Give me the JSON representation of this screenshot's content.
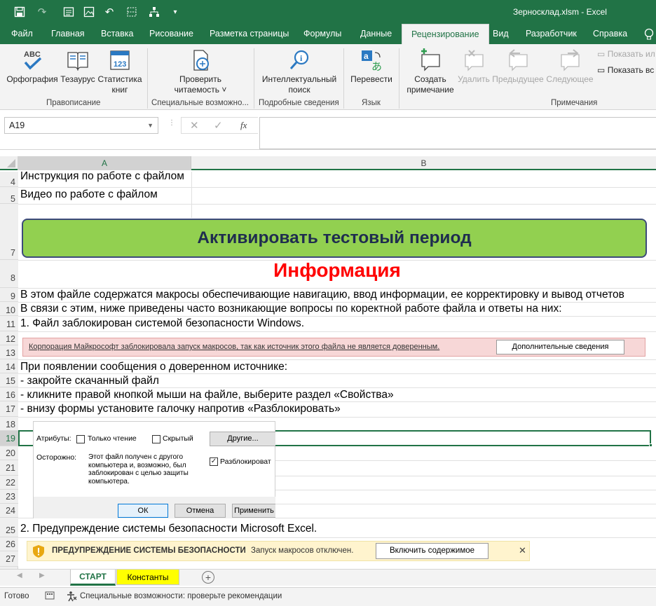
{
  "window": {
    "title": "Зерносклад.xlsm  -  Excel"
  },
  "ribbon_tabs": [
    "Файл",
    "Главная",
    "Вставка",
    "Рисование",
    "Разметка страницы",
    "Формулы",
    "Данные",
    "Рецензирование",
    "Вид",
    "Разработчик",
    "Справка"
  ],
  "ribbon": {
    "spelling": "Орфография",
    "thesaurus": "Тезаурус",
    "stats_line1": "Статистика",
    "stats_line2": "книг",
    "check_line1": "Проверить",
    "check_line2": "читаемость ˅",
    "smart_line1": "Интеллектуальный",
    "smart_line2": "поиск",
    "translate": "Перевести",
    "new_comment_line1": "Создать",
    "new_comment_line2": "примечание",
    "delete": "Удалить",
    "previous": "Предыдущее",
    "next": "Следующее",
    "show_note": "Показать ил",
    "show_all": "Показать вс",
    "groups": {
      "proofing": "Правописание",
      "accessibility": "Специальные возможно...",
      "insights": "Подробные сведения",
      "language": "Язык",
      "comments": "Примечания"
    },
    "icons": [
      "spellcheck-icon",
      "thesaurus-icon",
      "workbook-stats-icon",
      "accessibility-check-icon",
      "smart-lookup-icon",
      "translate-icon",
      "new-comment-icon",
      "delete-comment-icon",
      "previous-comment-icon",
      "next-comment-icon"
    ]
  },
  "formula_bar": {
    "name_box": "A19",
    "cancel": "✕",
    "enter": "✓",
    "fx": "fx"
  },
  "columns": {
    "a": "A",
    "b": "B"
  },
  "rows": {
    "r4": "Инструкция по работе с файлом",
    "r5": "Видео по работе с файлом",
    "r7_button": "Активировать тестовый период",
    "r8_title": "Информация",
    "r9": "В этом файле содержатся макросы обеспечивающие навигацию, ввод информации, ее корректировку и вывод отчетов",
    "r10": "В связи с этим, ниже приведены часто возникающие  вопросы по коректной работе файла и ответы на них:",
    "r11": "1. Файл заблокирован системой безопасности Windows.",
    "r14": "При появлении сообщения о доверенном источнике:",
    "r15": "- закройте скачанный файл",
    "r16": "- кликните правой кнопкой мыши на файле, выберите раздел «Свойства»",
    "r17": "- внизу формы установите галочку напротив «Разблокировать»",
    "r25": "2. Предупреждение системы безопасности Microsoft Excel."
  },
  "row_numbers": [
    "4",
    "5",
    "7",
    "8",
    "9",
    "10",
    "11",
    "12",
    "13",
    "14",
    "15",
    "16",
    "17",
    "18",
    "19",
    "20",
    "21",
    "22",
    "23",
    "24",
    "25",
    "26",
    "27"
  ],
  "macro_bar": {
    "message": "Корпорация Майкрософт заблокировала запуск макросов, так как источник этого файла не является доверенным.",
    "button": "Дополнительные сведения"
  },
  "dialog": {
    "attributes_label": "Атрибуты:",
    "readonly": "Только чтение",
    "hidden": "Скрытый",
    "other": "Другие...",
    "caution_label": "Осторожно:",
    "caution_text": "Этот файл получен с другого компьютера и, возможно, был заблокирован с целью защиты компьютера.",
    "unblock": "Разблокироват",
    "unblock_checked": true,
    "ok": "ОК",
    "cancel": "Отмена",
    "apply": "Применить"
  },
  "security_bar": {
    "title": "ПРЕДУПРЕЖДЕНИЕ СИСТЕМЫ БЕЗОПАСНОСТИ",
    "message": "Запуск макросов отключен.",
    "button": "Включить содержимое",
    "close": "✕"
  },
  "sheets": {
    "tab1": "СТАРТ",
    "tab2": "Константы",
    "add": "+"
  },
  "status": {
    "ready": "Готово",
    "accessibility": "Специальные возможности: проверьте рекомендации"
  },
  "colors": {
    "excel_green": "#217346",
    "button_green": "#92d050",
    "title_red": "#ff0000",
    "sheet_tab_yellow": "#ffff00"
  }
}
